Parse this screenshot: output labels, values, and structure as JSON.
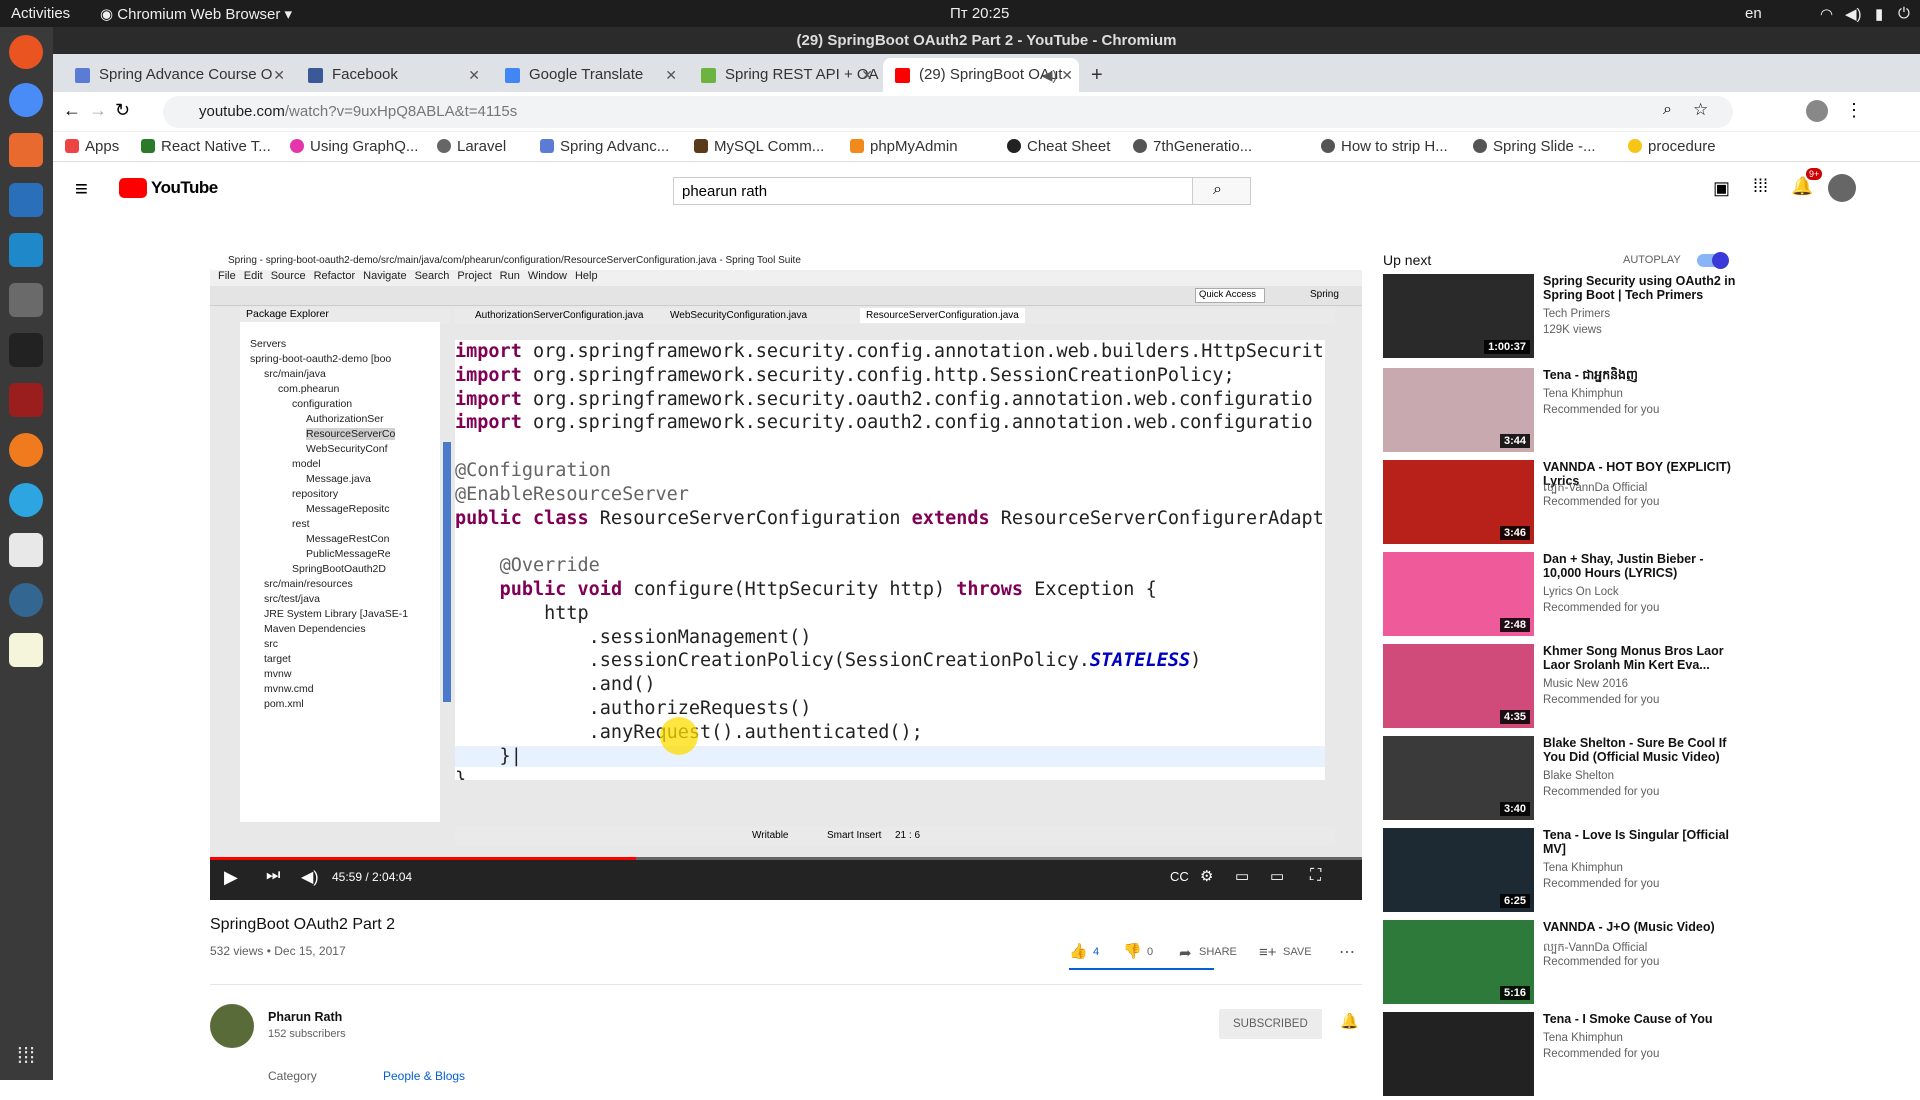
{
  "os_bar": {
    "activities": "Activities",
    "app_menu": "Chromium Web Browser",
    "clock": "Пт 20:25",
    "lang": "en"
  },
  "window": {
    "title": "(29) SpringBoot OAuth2 Part 2 - YouTube - Chromium"
  },
  "tabs": [
    {
      "label": "Spring Advance Course O",
      "color": "#5b7bd5"
    },
    {
      "label": "Facebook",
      "color": "#3b5998"
    },
    {
      "label": "Google Translate",
      "color": "#4285f4"
    },
    {
      "label": "Spring REST API + OAuth2",
      "color": "#6db33f"
    },
    {
      "label": "(29) SpringBoot OAut",
      "color": "#ff0000"
    }
  ],
  "address": {
    "url_host": "youtube.com",
    "url_path": "/watch?v=9uxHpQ8ABLA&t=4115s"
  },
  "bookmarks": [
    "Apps",
    "React Native T...",
    "Using GraphQ...",
    "Laravel",
    "Spring Advanc...",
    "MySQL Comm...",
    "phpMyAdmin",
    "Cheat Sheet",
    "7thGeneratio...",
    "How to strip H...",
    "Spring Slide -...",
    "procedure"
  ],
  "youtube": {
    "logo": "YouTube",
    "search_value": "phearun rath",
    "notif_count": "9+",
    "video": {
      "title": "SpringBoot OAuth2 Part 2",
      "meta": "532 views • Dec 15, 2017",
      "likes": "4",
      "dislikes": "0",
      "share": "SHARE",
      "save": "SAVE",
      "time": "45:59 / 2:04:04",
      "progress": 0.37
    },
    "channel": {
      "name": "Pharun Rath",
      "subs": "152 subscribers",
      "subscribed": "SUBSCRIBED",
      "category_label": "Category",
      "category": "People & Blogs"
    },
    "upnext": {
      "label": "Up next",
      "autoplay": "AUTOPLAY"
    },
    "cards": [
      {
        "title": "Spring Security using OAuth2 in Spring Boot | Tech Primers",
        "channel": "Tech Primers",
        "meta": "129K views",
        "dur": "1:00:37",
        "bg": "#2a2a2a"
      },
      {
        "title": "Tena - ជាអ្នកនិងញ",
        "channel": "Tena Khimphun",
        "meta": "Recommended for you",
        "dur": "3:44",
        "bg": "#c9a9b0"
      },
      {
        "title": "VANNDA - HOT BOY (EXPLICIT) Lyrics",
        "channel": "ល្បក-VannDa Official",
        "meta": "Recommended for you",
        "dur": "3:46",
        "bg": "#b8211a"
      },
      {
        "title": "Dan + Shay, Justin Bieber - 10,000 Hours (LYRICS)",
        "channel": "Lyrics On Lock",
        "meta": "Recommended for you",
        "dur": "2:48",
        "bg": "#ef5a9a"
      },
      {
        "title": "Khmer Song Monus Bros Laor Laor Srolanh Min Kert Eva...",
        "channel": "Music New 2016",
        "meta": "Recommended for you",
        "dur": "4:35",
        "bg": "#d04a7a"
      },
      {
        "title": "Blake Shelton - Sure Be Cool If You Did (Official Music Video)",
        "channel": "Blake Shelton",
        "meta": "Recommended for you",
        "dur": "3:40",
        "bg": "#3a3a3a"
      },
      {
        "title": "Tena - Love Is Singular [Official MV]",
        "channel": "Tena Khimphun",
        "meta": "Recommended for you",
        "dur": "6:25",
        "bg": "#1e2a33"
      },
      {
        "title": "VANNDA - J+O (Music Video)",
        "channel": "ល្បក-VannDa Official",
        "meta": "Recommended for you",
        "dur": "5:16",
        "bg": "#2d7a3a"
      },
      {
        "title": "Tena - I Smoke Cause of You",
        "channel": "Tena Khimphun",
        "meta": "Recommended for you",
        "dur": "",
        "bg": "#222"
      }
    ]
  },
  "ide": {
    "title": "Spring - spring-boot-oauth2-demo/src/main/java/com/phearun/configuration/ResourceServerConfiguration.java - Spring Tool Suite",
    "menu": [
      "File",
      "Edit",
      "Source",
      "Refactor",
      "Navigate",
      "Search",
      "Project",
      "Run",
      "Window",
      "Help"
    ],
    "quick_access": "Quick Access",
    "perspective": "Spring",
    "editor_tabs": [
      "AuthorizationServerConfiguration.java",
      "WebSecurityConfiguration.java",
      "ResourceServerConfiguration.java"
    ],
    "pkg_title": "Package Explorer",
    "tree": [
      "Servers",
      "spring-boot-oauth2-demo [boo",
      "src/main/java",
      "com.phearun",
      "configuration",
      "AuthorizationSer",
      "ResourceServerCo",
      "WebSecurityConf",
      "model",
      "Message.java",
      "repository",
      "MessageRepositc",
      "rest",
      "MessageRestCon",
      "PublicMessageRe",
      "SpringBootOauth2D",
      "src/main/resources",
      "src/test/java",
      "JRE System Library [JavaSE-1",
      "Maven Dependencies",
      "src",
      "target",
      "mvnw",
      "mvnw.cmd",
      "pom.xml"
    ],
    "status": {
      "writable": "Writable",
      "insert": "Smart Insert",
      "pos": "21 : 6"
    }
  }
}
